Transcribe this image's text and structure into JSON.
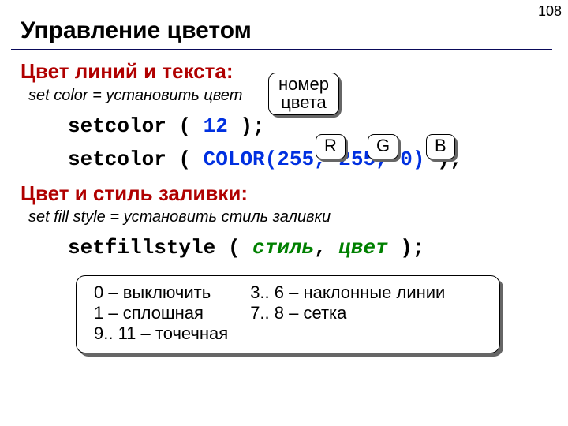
{
  "page_number": "108",
  "title": "Управление цветом",
  "section1": {
    "heading": "Цвет линий и текста:",
    "def": "set color = установить цвет",
    "callout": {
      "line1": "номер",
      "line2": "цвета"
    },
    "code1_a": "setcolor",
    "code1_b": " ( ",
    "code1_num": "12",
    "code1_c": " );",
    "r": "R",
    "g": "G",
    "b": "B",
    "code2_a": "setcolor",
    "code2_b": " ( ",
    "code2_fn": "COLOR(255, 255, 0)",
    "code2_c": " );"
  },
  "section2": {
    "heading": "Цвет и стиль заливки:",
    "def": "set fill style = установить стиль заливки",
    "code_a": "setfillstyle",
    "code_b": " ( ",
    "arg1": "стиль",
    "comma": ", ",
    "arg2": "цвет",
    "code_c": " );"
  },
  "styles_box": {
    "c1a": "0 – выключить",
    "c1b": "1 – сплошная",
    "c1c": "9.. 11 – точечная",
    "c2a": "3.. 6 – наклонные линии",
    "c2b": "7.. 8 – сетка"
  }
}
